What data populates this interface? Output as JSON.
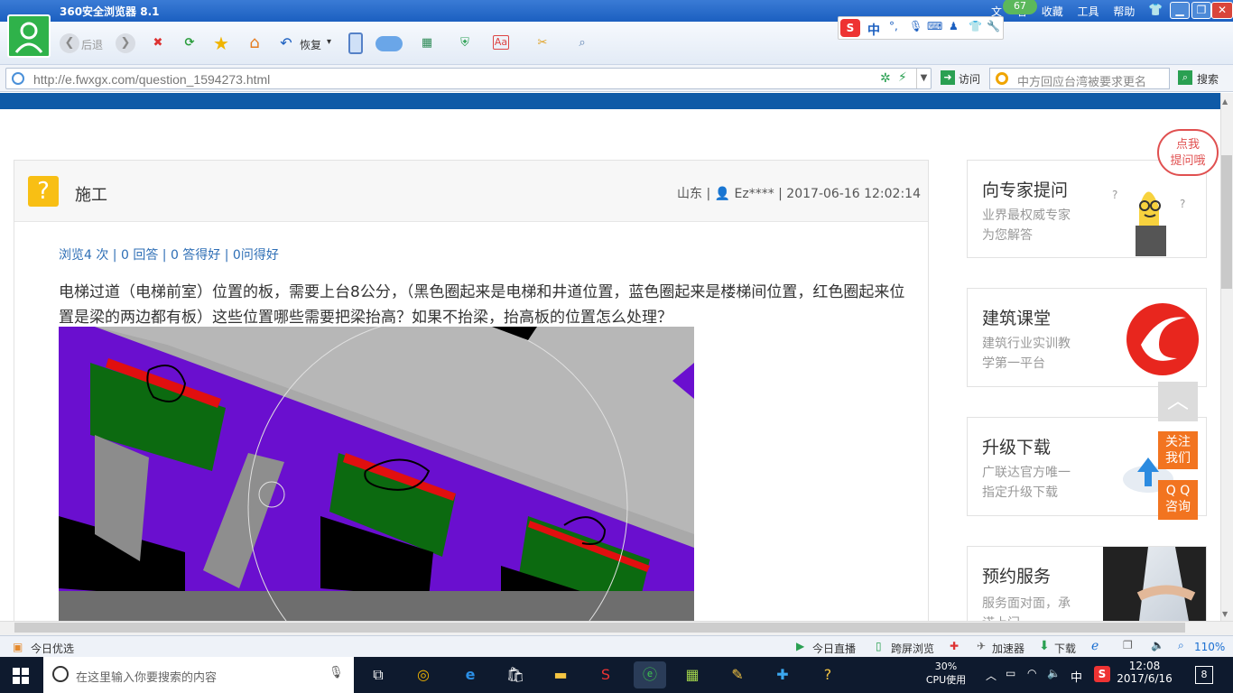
{
  "browser": {
    "title": "360安全浏览器 8.1",
    "menu": [
      "文",
      "看",
      "收藏",
      "工具",
      "帮助"
    ],
    "badge": "67",
    "nav": {
      "back_label": "后退",
      "restore_label": "恢复"
    },
    "ime_label": "中",
    "url": "http://e.fwxgx.com/question_1594273.html",
    "visit_label": "访问",
    "search_placeholder": "中方回应台湾被要求更名",
    "search_button": "搜索"
  },
  "question": {
    "title": "施工",
    "meta": "山东 | 👤 Ez**** | 2017-06-16 12:02:14",
    "stats": "浏览4 次 | 0 回答 | 0 答得好 | 0问得好",
    "body": "电梯过道（电梯前室）位置的板，需要上台8公分，（黑色圈起来是电梯和井道位置，蓝色圈起来是楼梯间位置，红色圈起来位置是梁的两边都有板）这些位置哪些需要把梁抬高？如果不抬梁，抬高板的位置怎么处理？"
  },
  "sidebar": {
    "bubble": "点我\n提问哦",
    "cards": [
      {
        "title": "向专家提问",
        "sub1": "业界最权威专家",
        "sub2": "为您解答"
      },
      {
        "title": "建筑课堂",
        "sub1": "建筑行业实训教",
        "sub2": "学第一平台"
      },
      {
        "title": "升级下载",
        "sub1": "广联达官方唯一",
        "sub2": "指定升级下载"
      },
      {
        "title": "预约服务",
        "sub1": "服务面对面，承",
        "sub2": "诺上门"
      }
    ],
    "follow": "关注\n我们",
    "qq": "Q Q\n咨询"
  },
  "statusbar": {
    "left": "今日优选",
    "live": "今日直播",
    "cross": "跨屏浏览",
    "accel": "加速器",
    "download": "下载",
    "zoom": "110%"
  },
  "taskbar": {
    "search_placeholder": "在这里输入你要搜索的内容",
    "cpu_pct": "30%",
    "cpu_label": "CPU使用",
    "ime": "中",
    "time": "12:08",
    "date": "2017/6/16",
    "notif": "8"
  },
  "colors": {
    "accent": "#0e5aa7",
    "question_icon": "#f8bf14",
    "float": "#f27420"
  }
}
